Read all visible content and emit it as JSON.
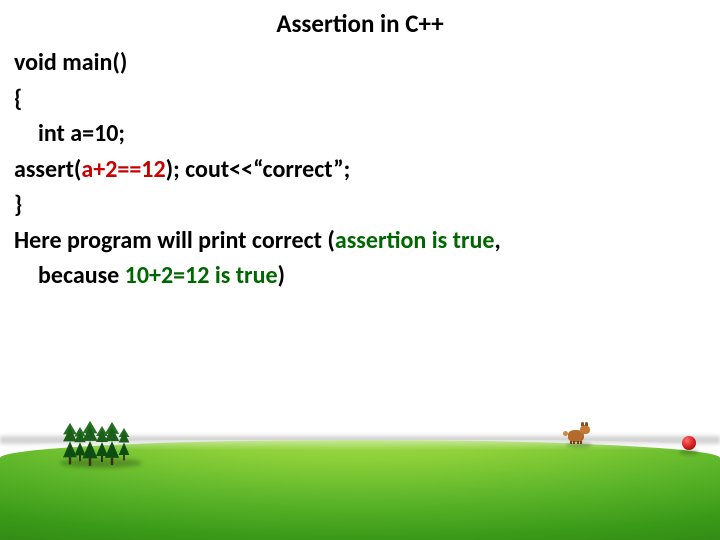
{
  "title": "Assertion in C++",
  "code": {
    "l1": "void main()",
    "l2": "{",
    "l3": "int a=10;",
    "l4a": "assert(",
    "l4b": "a+2==12",
    "l4c": "); cout<<“correct”;",
    "l5": "}"
  },
  "explain": {
    "p1a": "Here program will print correct (",
    "p1b": "assertion is true",
    "p1c": ",",
    "p2a": "because ",
    "p2b": "10+2=12 is true",
    "p2c": ")"
  }
}
